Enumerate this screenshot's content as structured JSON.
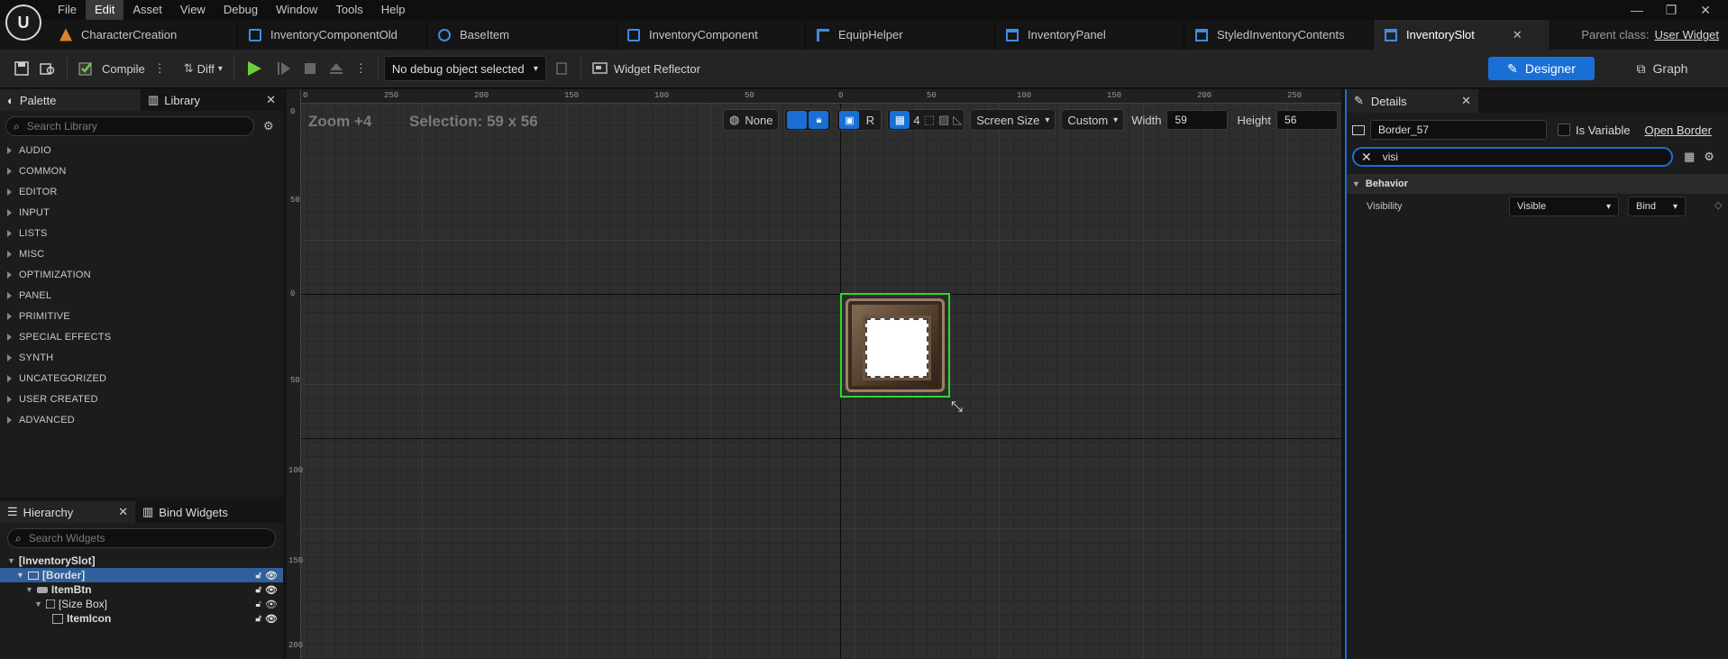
{
  "app": {
    "logo": "U"
  },
  "menu": [
    "File",
    "Edit",
    "Asset",
    "View",
    "Debug",
    "Window",
    "Tools",
    "Help"
  ],
  "window_controls": {
    "minimize": "—",
    "restore": "❐",
    "close": "✕"
  },
  "tabs": [
    {
      "label": "CharacterCreation",
      "icon": "material-icon",
      "color": "#e0802a"
    },
    {
      "label": "InventoryComponentOld",
      "icon": "blueprint-icon",
      "color": "#3d8ce6"
    },
    {
      "label": "BaseItem",
      "icon": "blueprint-icon",
      "color": "#3d8ce6"
    },
    {
      "label": "InventoryComponent",
      "icon": "blueprint-icon",
      "color": "#3d8ce6"
    },
    {
      "label": "EquipHelper",
      "icon": "function-library-icon",
      "color": "#3d8ce6"
    },
    {
      "label": "InventoryPanel",
      "icon": "widget-blueprint-icon",
      "color": "#3d8ce6"
    },
    {
      "label": "StyledInventoryContents",
      "icon": "widget-blueprint-icon",
      "color": "#3d8ce6"
    },
    {
      "label": "InventorySlot",
      "icon": "widget-blueprint-icon",
      "color": "#3d8ce6",
      "active": true,
      "close": "✕"
    }
  ],
  "parent_class": {
    "label": "Parent class:",
    "value": "User Widget"
  },
  "toolbar": {
    "compile": "Compile",
    "diff": "Diff",
    "debug_object": "No debug object selected",
    "widget_reflector": "Widget Reflector",
    "designer": "Designer",
    "graph": "Graph"
  },
  "palette": {
    "tab_palette": "Palette",
    "tab_library": "Library",
    "close": "✕",
    "search_placeholder": "Search Library",
    "categories": [
      "AUDIO",
      "COMMON",
      "EDITOR",
      "INPUT",
      "LISTS",
      "MISC",
      "OPTIMIZATION",
      "PANEL",
      "PRIMITIVE",
      "SPECIAL EFFECTS",
      "SYNTH",
      "UNCATEGORIZED",
      "USER CREATED",
      "ADVANCED"
    ]
  },
  "hierarchy": {
    "tab_hierarchy": "Hierarchy",
    "tab_bind": "Bind Widgets",
    "close": "✕",
    "search_placeholder": "Search Widgets",
    "rows": [
      {
        "label": "[InventorySlot]"
      },
      {
        "label": "[Border]",
        "selected": true
      },
      {
        "label": "ItemBtn"
      },
      {
        "label": "[Size Box]"
      },
      {
        "label": "ItemIcon"
      }
    ]
  },
  "canvas": {
    "zoom": "Zoom +4",
    "selection": "Selection: 59 x 56",
    "localization": "None",
    "r_toggle": "R",
    "grid_snap": "4",
    "screen_size": "Screen Size",
    "size_mode": "Custom",
    "width_label": "Width",
    "width_value": "59",
    "height_label": "Height",
    "height_value": "56",
    "ruler_top": [
      "250",
      "200",
      "150",
      "100",
      "50",
      "0",
      "50",
      "100",
      "150",
      "200",
      "250"
    ],
    "ruler_left": [
      "0",
      "50",
      "0",
      "50",
      "100",
      "150",
      "200"
    ]
  },
  "details": {
    "title": "Details",
    "close": "✕",
    "name": "Border_57",
    "is_variable": "Is Variable",
    "open_border": "Open Border",
    "search_value": "visi",
    "section": "Behavior",
    "property": "Visibility",
    "value": "Visible",
    "bind": "Bind"
  }
}
